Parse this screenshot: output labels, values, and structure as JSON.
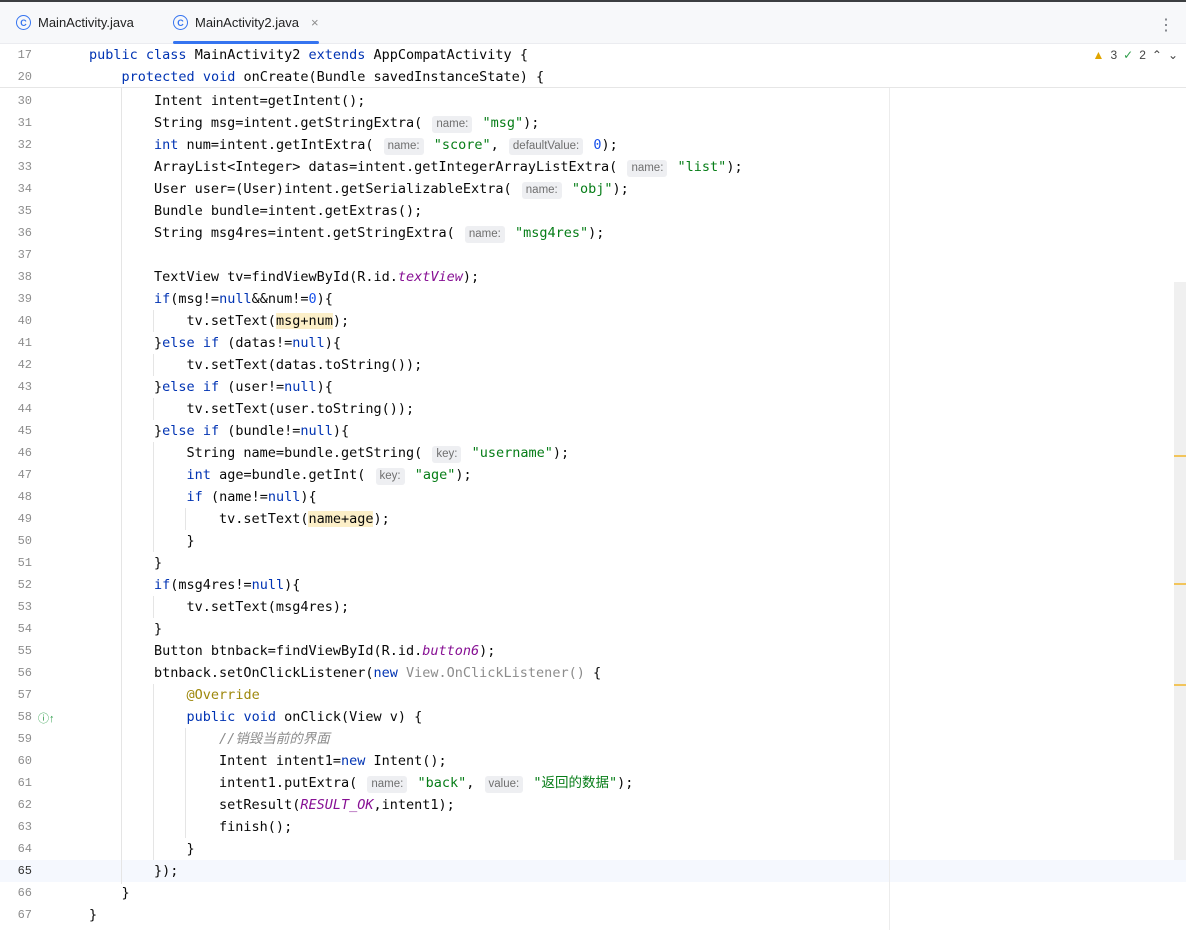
{
  "tabs": [
    {
      "label": "MainActivity.java",
      "active": false,
      "icon": "java-class-icon"
    },
    {
      "label": "MainActivity2.java",
      "active": true,
      "icon": "java-class-icon"
    }
  ],
  "tab_close": "×",
  "more_menu": "⋮",
  "inspection": {
    "warnings": "3",
    "ok": "2",
    "nav_up": "⌃",
    "nav_down": "⌄"
  },
  "current_line": "65",
  "lines": [
    {
      "n": "17",
      "t": "public class MainActivity2 extends AppCompatActivity {"
    },
    {
      "n": "20",
      "t": "    protected void onCreate(Bundle savedInstanceState) {"
    },
    {
      "n": "30",
      "t": "        Intent intent=getIntent();"
    },
    {
      "n": "31",
      "t": "        String msg=intent.getStringExtra( name: \"msg\");"
    },
    {
      "n": "32",
      "t": "        int num=intent.getIntExtra( name: \"score\", defaultValue: 0);"
    },
    {
      "n": "33",
      "t": "        ArrayList<Integer> datas=intent.getIntegerArrayListExtra( name: \"list\");"
    },
    {
      "n": "34",
      "t": "        User user=(User)intent.getSerializableExtra( name: \"obj\");"
    },
    {
      "n": "35",
      "t": "        Bundle bundle=intent.getExtras();"
    },
    {
      "n": "36",
      "t": "        String msg4res=intent.getStringExtra( name: \"msg4res\");"
    },
    {
      "n": "37",
      "t": ""
    },
    {
      "n": "38",
      "t": "        TextView tv=findViewById(R.id.textView);"
    },
    {
      "n": "39",
      "t": "        if(msg!=null&&num!=0){"
    },
    {
      "n": "40",
      "t": "            tv.setText(msg+num);"
    },
    {
      "n": "41",
      "t": "        }else if (datas!=null){"
    },
    {
      "n": "42",
      "t": "            tv.setText(datas.toString());"
    },
    {
      "n": "43",
      "t": "        }else if (user!=null){"
    },
    {
      "n": "44",
      "t": "            tv.setText(user.toString());"
    },
    {
      "n": "45",
      "t": "        }else if (bundle!=null){"
    },
    {
      "n": "46",
      "t": "            String name=bundle.getString( key: \"username\");"
    },
    {
      "n": "47",
      "t": "            int age=bundle.getInt( key: \"age\");"
    },
    {
      "n": "48",
      "t": "            if (name!=null){"
    },
    {
      "n": "49",
      "t": "                tv.setText(name+age);"
    },
    {
      "n": "50",
      "t": "            }"
    },
    {
      "n": "51",
      "t": "        }"
    },
    {
      "n": "52",
      "t": "        if(msg4res!=null){"
    },
    {
      "n": "53",
      "t": "            tv.setText(msg4res);"
    },
    {
      "n": "54",
      "t": "        }"
    },
    {
      "n": "55",
      "t": "        Button btnback=findViewById(R.id.button6);"
    },
    {
      "n": "56",
      "t": "        btnback.setOnClickListener(new View.OnClickListener() {"
    },
    {
      "n": "57",
      "t": "            @Override"
    },
    {
      "n": "58",
      "t": "            public void onClick(View v) {"
    },
    {
      "n": "59",
      "t": "                //销毁当前的界面"
    },
    {
      "n": "60",
      "t": "                Intent intent1=new Intent();"
    },
    {
      "n": "61",
      "t": "                intent1.putExtra( name: \"back\", value: \"返回的数据\");"
    },
    {
      "n": "62",
      "t": "                setResult(RESULT_OK,intent1);"
    },
    {
      "n": "63",
      "t": "                finish();"
    },
    {
      "n": "64",
      "t": "            }"
    },
    {
      "n": "65",
      "t": "        });"
    },
    {
      "n": "66",
      "t": "    }"
    },
    {
      "n": "67",
      "t": "}"
    }
  ]
}
